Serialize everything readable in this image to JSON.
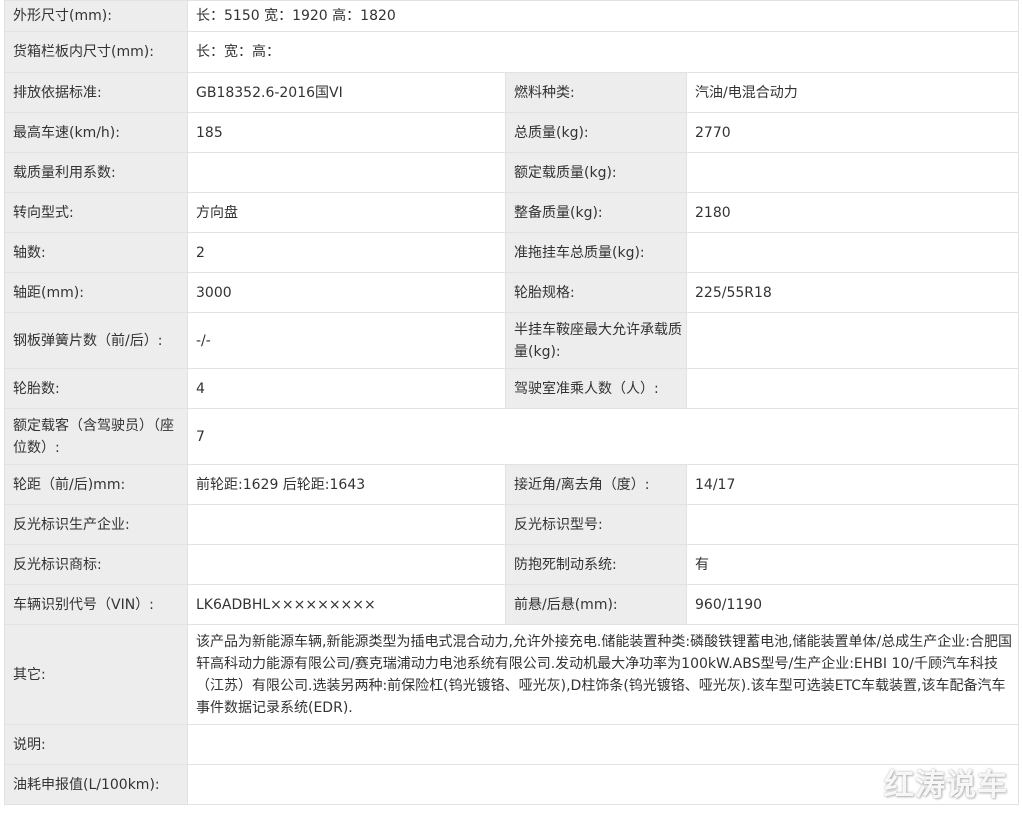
{
  "rows": [
    {
      "l1": "外形尺寸(mm):",
      "v1": "长：5150 宽：1920 高：1820"
    },
    {
      "l1": "货箱栏板内尺寸(mm):",
      "v1": "长：宽：高："
    },
    {
      "l1": "排放依据标准:",
      "v1": "GB18352.6-2016国VI",
      "l2": "燃料种类:",
      "v2": "汽油/电混合动力"
    },
    {
      "l1": "最高车速(km/h):",
      "v1": "185",
      "l2": "总质量(kg):",
      "v2": "2770"
    },
    {
      "l1": "载质量利用系数:",
      "v1": "",
      "l2": "额定载质量(kg):",
      "v2": ""
    },
    {
      "l1": "转向型式:",
      "v1": "方向盘",
      "l2": "整备质量(kg):",
      "v2": "2180"
    },
    {
      "l1": "轴数:",
      "v1": "2",
      "l2": "准拖挂车总质量(kg):",
      "v2": ""
    },
    {
      "l1": "轴距(mm):",
      "v1": "3000",
      "l2": "轮胎规格:",
      "v2": "225/55R18"
    },
    {
      "l1": "钢板弹簧片数（前/后）:",
      "v1": "-/-",
      "l2": "半挂车鞍座最大允许承载质量(kg):",
      "v2": ""
    },
    {
      "l1": "轮胎数:",
      "v1": "4",
      "l2": "驾驶室准乘人数（人）:",
      "v2": ""
    },
    {
      "l1": "额定载客（含驾驶员）（座位数）:",
      "v1": "7"
    },
    {
      "l1": "轮距（前/后)mm:",
      "v1": "前轮距:1629 后轮距:1643",
      "l2": "接近角/离去角（度）:",
      "v2": "14/17"
    },
    {
      "l1": "反光标识生产企业:",
      "v1": "",
      "l2": "反光标识型号:",
      "v2": ""
    },
    {
      "l1": "反光标识商标:",
      "v1": "",
      "l2": "防抱死制动系统:",
      "v2": "有"
    },
    {
      "l1": "车辆识别代号（VIN）:",
      "v1": "LK6ADBHL×××××××××",
      "l2": "前悬/后悬(mm):",
      "v2": "960/1190"
    },
    {
      "l1": "其它:",
      "v1": "该产品为新能源车辆,新能源类型为插电式混合动力,允许外接充电.储能装置种类:磷酸铁锂蓄电池,储能装置单体/总成生产企业:合肥国轩高科动力能源有限公司/赛克瑞浦动力电池系统有限公司.发动机最大净功率为100kW.ABS型号/生产企业:EHBI 10/千顾汽车科技（江苏）有限公司.选装另两种:前保险杠(钨光镀铬、哑光灰),D柱饰条(钨光镀铬、哑光灰).该车型可选装ETC车载装置,该车配备汽车事件数据记录系统(EDR)."
    },
    {
      "l1": "说明:",
      "v1": ""
    },
    {
      "l1": "油耗申报值(L/100km):",
      "v1": ""
    }
  ],
  "watermark": "红涛说车"
}
